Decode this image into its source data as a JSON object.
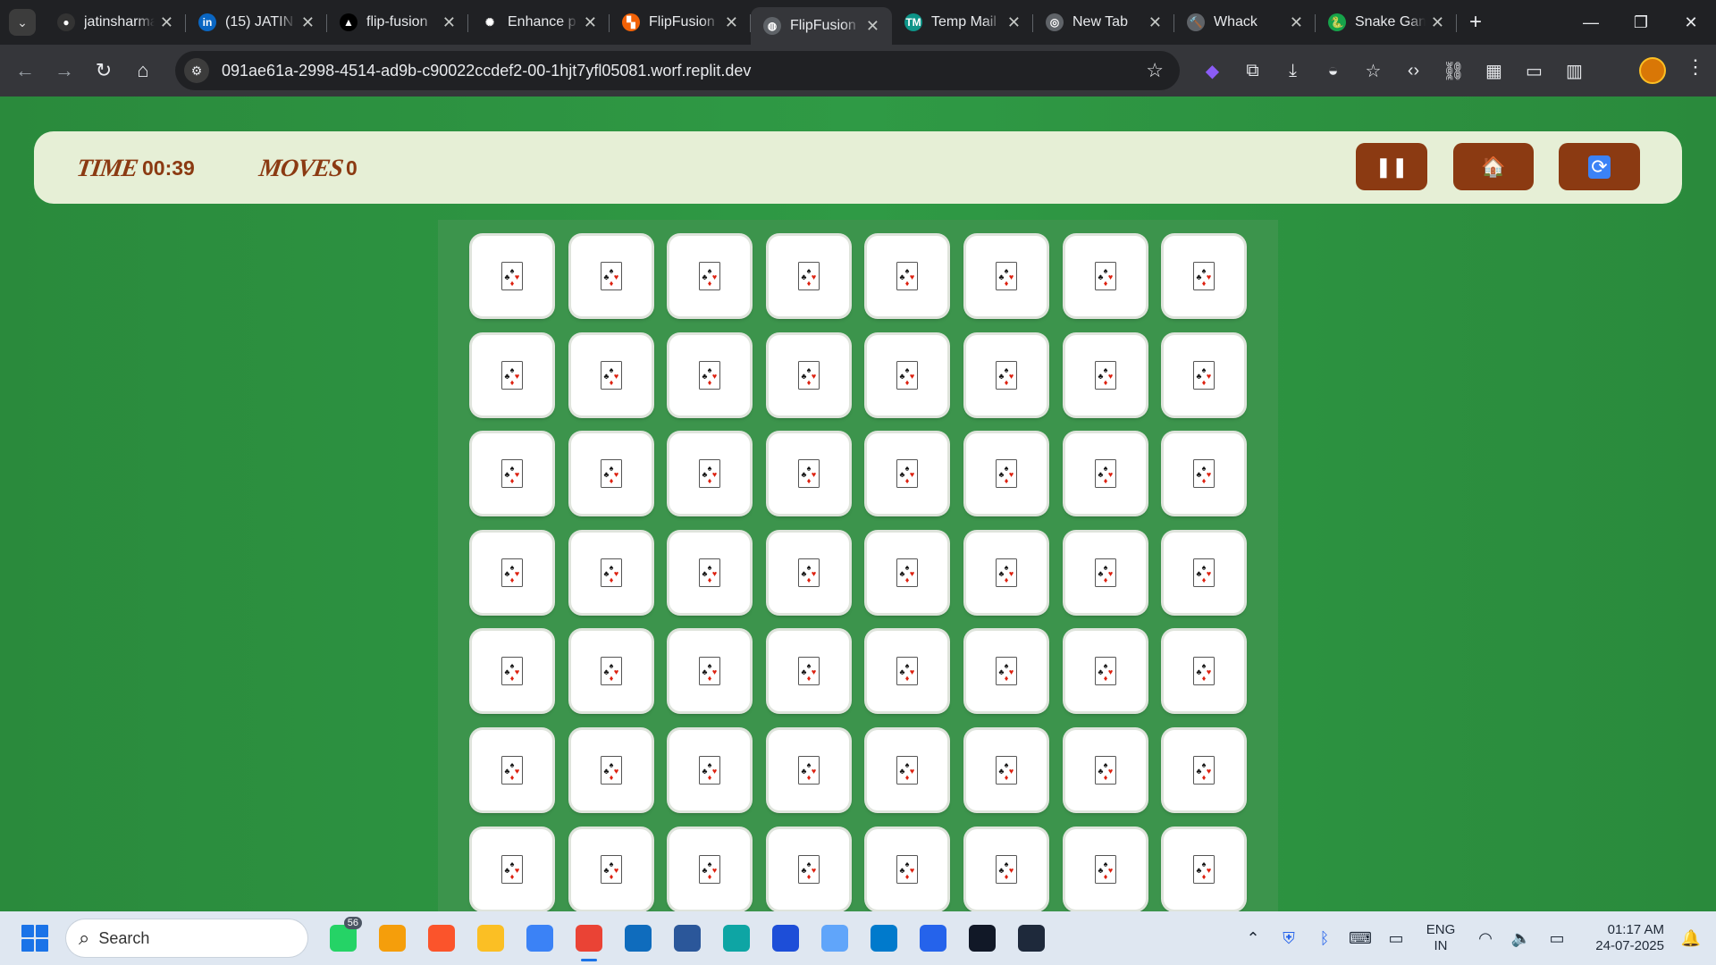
{
  "browser": {
    "tabs": [
      {
        "title": "jatinsharma",
        "favicon": "github-icon",
        "color": "#333333",
        "glyph": "●"
      },
      {
        "title": "(15) JATIN",
        "favicon": "linkedin-icon",
        "color": "#0a66c2",
        "glyph": "in"
      },
      {
        "title": "flip-fusion",
        "favicon": "vercel-icon",
        "color": "#000000",
        "glyph": "▲"
      },
      {
        "title": "Enhance p",
        "favicon": "openai-icon",
        "color": "#202124",
        "glyph": "✺"
      },
      {
        "title": "FlipFusion",
        "favicon": "replit-icon",
        "color": "#f26207",
        "glyph": "▚"
      },
      {
        "title": "FlipFusion",
        "favicon": "globe-icon",
        "color": "#5f6368",
        "glyph": "◍",
        "active": true
      },
      {
        "title": "Temp Mail",
        "favicon": "tempmail-icon",
        "color": "#0d9488",
        "glyph": "TM"
      },
      {
        "title": "New Tab",
        "favicon": "chrome-icon",
        "color": "#5f6368",
        "glyph": "◎"
      },
      {
        "title": "Whack",
        "favicon": "hammer-icon",
        "color": "#5f6368",
        "glyph": "🔨"
      },
      {
        "title": "Snake Gan",
        "favicon": "snake-icon",
        "color": "#16a34a",
        "glyph": "🐍"
      }
    ],
    "url": "091ae61a-2998-4514-ad9b-c90022ccdef2-00-1hjt7yfl05081.worf.replit.dev"
  },
  "game": {
    "time_label": "TIME",
    "time_value": "00:39",
    "moves_label": "MOVES",
    "moves_value": "0",
    "buttons": [
      {
        "name": "pause-button",
        "icon": "pause-icon",
        "glyph": "⏸"
      },
      {
        "name": "home-button",
        "icon": "home-icon",
        "glyph": "🏠"
      },
      {
        "name": "restart-button",
        "icon": "restart-icon",
        "glyph": "🔄"
      }
    ],
    "board": {
      "columns": 8,
      "rows_visible": 7,
      "card_back": "card-suits-icon"
    }
  },
  "taskbar": {
    "search_placeholder": "Search",
    "apps": [
      {
        "name": "whatsapp-icon",
        "color": "#25d366",
        "badge": "56"
      },
      {
        "name": "files-app-icon",
        "color": "#f59e0b"
      },
      {
        "name": "brave-icon",
        "color": "#fb542b"
      },
      {
        "name": "file-explorer-icon",
        "color": "#fbbf24"
      },
      {
        "name": "notepad-icon",
        "color": "#3b82f6"
      },
      {
        "name": "chrome-icon",
        "color": "#ea4335",
        "active": true
      },
      {
        "name": "outlook-icon",
        "color": "#0f6cbd"
      },
      {
        "name": "word-icon",
        "color": "#2b579a"
      },
      {
        "name": "search-app-icon",
        "color": "#0ea5a4"
      },
      {
        "name": "mysql-workbench-icon",
        "color": "#1d4ed8"
      },
      {
        "name": "control-panel-icon",
        "color": "#60a5fa"
      },
      {
        "name": "vscode-icon",
        "color": "#007acc"
      },
      {
        "name": "powershell-icon",
        "color": "#2563eb"
      },
      {
        "name": "terminal-icon",
        "color": "#111827"
      },
      {
        "name": "mysql-shell-icon",
        "color": "#1e293b"
      }
    ],
    "lang_top": "ENG",
    "lang_bottom": "IN",
    "time": "01:17 AM",
    "date": "24-07-2025"
  }
}
